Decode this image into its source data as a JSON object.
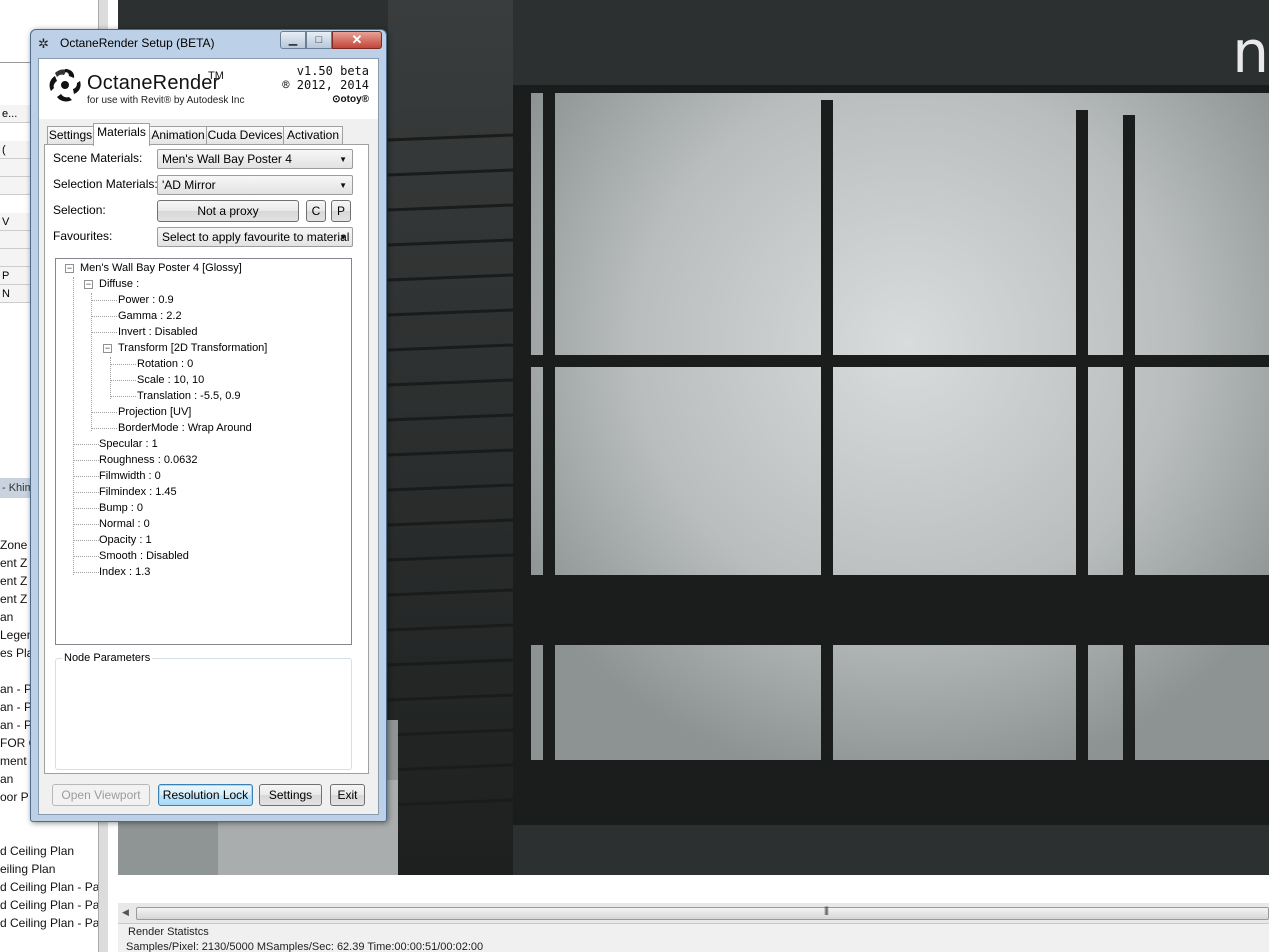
{
  "background_panel": {
    "prop_rows": [
      "e...",
      "(",
      "",
      "",
      "V",
      "",
      "",
      "P",
      "N"
    ],
    "browser_header": "- Khim",
    "list_items": [
      "Zone",
      "ent Z",
      "ent Z",
      "ent Z",
      "an",
      "Legen",
      "es Plar",
      "",
      "an - Pa",
      "an - Pa",
      "an - Pa",
      "FOR C",
      "ment Z",
      "an",
      "oor P",
      "",
      "",
      "d Ceiling Plan",
      "eiling Plan",
      "d Ceiling Plan - Par",
      "d Ceiling Plan - Par",
      "d Ceiling Plan - Par"
    ]
  },
  "window": {
    "title": "OctaneRender Setup (BETA)",
    "minimize_glyph": "▁",
    "maximize_glyph": "□",
    "close_glyph": "✕",
    "app_icon": "octane-icon"
  },
  "brand": {
    "name": "OctaneRender",
    "tm": "TM",
    "subtitle": "for use with Revit® by Autodesk Inc",
    "version": "v1.50 beta",
    "copyright": "® 2012, 2014",
    "otoy": "⊙otoy®"
  },
  "tabs": [
    {
      "label": "Settings",
      "active": false
    },
    {
      "label": "Materials",
      "active": true
    },
    {
      "label": "Animation",
      "active": false
    },
    {
      "label": "Cuda Devices",
      "active": false
    },
    {
      "label": "Activation",
      "active": false
    }
  ],
  "materials": {
    "scene_materials_label": "Scene Materials:",
    "scene_materials_value": "Men's Wall Bay Poster 4",
    "selection_materials_label": "Selection Materials:",
    "selection_materials_value": "'AD Mirror",
    "selection_label": "Selection:",
    "proxy_button": "Not a proxy",
    "c_button": "C",
    "p_button": "P",
    "favourites_label": "Favourites:",
    "favourites_value": "Select to apply favourite to material",
    "node_parameters_label": "Node Parameters"
  },
  "tree": {
    "root": "Men's Wall Bay Poster 4  [Glossy]",
    "diffuse": "Diffuse :",
    "power": "Power : 0.9",
    "gamma": "Gamma : 2.2",
    "invert": "Invert : Disabled",
    "transform": "Transform  [2D Transformation]",
    "rotation": "Rotation : 0",
    "scale": "Scale : 10, 10",
    "translation": "Translation : -5.5, 0.9",
    "projection": "Projection  [UV]",
    "bordermode": "BorderMode : Wrap Around",
    "specular": "Specular : 1",
    "roughness": "Roughness : 0.0632",
    "filmwidth": "Filmwidth : 0",
    "filmindex": "Filmindex : 1.45",
    "bump": "Bump : 0",
    "normal": "Normal : 0",
    "opacity": "Opacity : 1",
    "smooth": "Smooth : Disabled",
    "index": "Index : 1.3"
  },
  "footer_buttons": {
    "open_viewport": "Open Viewport",
    "resolution_lock": "Resolution Lock",
    "settings": "Settings",
    "exit": "Exit"
  },
  "render": {
    "corner_logo": "n",
    "scroll_arrow": "◀",
    "scroll_grip": "|||"
  },
  "stats": {
    "title": "Render Statistcs",
    "line": "Samples/Pixel: 2130/5000  MSamples/Sec: 62.39  Time:00:00:51/00:02:00"
  }
}
